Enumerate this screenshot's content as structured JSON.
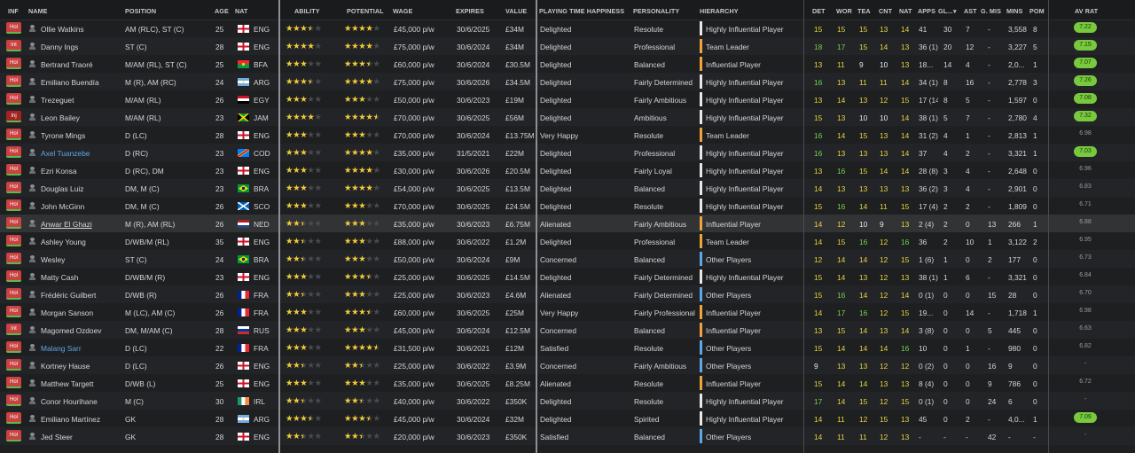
{
  "headers": {
    "inf": "INF",
    "name": "NAME",
    "position": "POSITION",
    "age": "AGE",
    "nat": "NAT",
    "ability": "ABILITY",
    "potential": "POTENTIAL",
    "wage": "WAGE",
    "expires": "EXPIRES",
    "value": "VALUE",
    "pth": "PLAYING TIME HAPPINESS",
    "personality": "PERSONALITY",
    "hierarchy": "HIERARCHY",
    "det": "DET",
    "wor": "WOR",
    "tea": "TEA",
    "cnt": "CNT",
    "nat2": "NAT",
    "apps": "APPS",
    "gls": "GL...",
    "sort_icon": "sort-desc-icon",
    "ast": "AST",
    "gmis": "G. MIS",
    "mins": "MINS",
    "pom": "POM",
    "avrat": "AV RAT"
  },
  "colors": {
    "badge": "#c94141",
    "star": "#f2cb3a",
    "good_rating": "#79c93e",
    "hierarchy_leader": "#f2a43a",
    "hierarchy_other": "#5da8e6",
    "hierarchy_high": "#e8e8e8"
  },
  "players": [
    {
      "inf": "Hol",
      "name": "Ollie Watkins",
      "position": "AM (RLC), ST (C)",
      "age": "25",
      "flag": "eng",
      "nat": "ENG",
      "ability": 3.5,
      "potential": 4,
      "wage": "£45,000 p/w",
      "expires": "30/6/2025",
      "value": "£34M",
      "pth": "Delighted",
      "personality": "Resolute",
      "hierarchy": "Highly Influential Player",
      "htier": "high",
      "det": "15",
      "wor": "15",
      "tea": "15",
      "cnt": "13",
      "nat2": "14",
      "apps": "41",
      "gls": "30",
      "ast": "7",
      "gmis": "-",
      "mins": "3,558",
      "pom": "8",
      "avrat": "7.22",
      "avgood": true
    },
    {
      "inf": "Int",
      "name": "Danny Ings",
      "position": "ST (C)",
      "age": "28",
      "flag": "eng",
      "nat": "ENG",
      "ability": 4,
      "potential": 4,
      "wage": "£75,000 p/w",
      "expires": "30/6/2024",
      "value": "£34M",
      "pth": "Delighted",
      "personality": "Professional",
      "hierarchy": "Team Leader",
      "htier": "leader",
      "det": "18",
      "wor": "17",
      "tea": "15",
      "cnt": "14",
      "nat2": "13",
      "apps": "36 (1)",
      "gls": "20",
      "ast": "12",
      "gmis": "-",
      "mins": "3,227",
      "pom": "5",
      "avrat": "7.15",
      "avgood": true
    },
    {
      "inf": "Hol",
      "name": "Bertrand Traoré",
      "position": "M/AM (RL), ST (C)",
      "age": "25",
      "flag": "bfa",
      "nat": "BFA",
      "ability": 3,
      "potential": 3.5,
      "wage": "£60,000 p/w",
      "expires": "30/6/2024",
      "value": "£30.5M",
      "pth": "Delighted",
      "personality": "Balanced",
      "hierarchy": "Influential Player",
      "htier": "leader",
      "det": "13",
      "wor": "11",
      "tea": "9",
      "cnt": "10",
      "nat2": "13",
      "apps": "18...",
      "gls": "14",
      "ast": "4",
      "gmis": "-",
      "mins": "2,0...",
      "pom": "1",
      "avrat": "7.07",
      "avgood": true
    },
    {
      "inf": "Hol",
      "name": "Emiliano Buendía",
      "position": "M (R), AM (RC)",
      "age": "24",
      "flag": "arg",
      "nat": "ARG",
      "ability": 3.5,
      "potential": 4,
      "wage": "£75,000 p/w",
      "expires": "30/6/2026",
      "value": "£34.5M",
      "pth": "Delighted",
      "personality": "Fairly Determined",
      "hierarchy": "Highly Influential Player",
      "htier": "high",
      "det": "16",
      "wor": "13",
      "tea": "11",
      "cnt": "11",
      "nat2": "14",
      "apps": "34 (1)",
      "gls": "8",
      "ast": "16",
      "gmis": "-",
      "mins": "2,778",
      "pom": "3",
      "avrat": "7.26",
      "avgood": true
    },
    {
      "inf": "Hol",
      "name": "Trezeguet",
      "position": "M/AM (RL)",
      "age": "26",
      "flag": "egy",
      "nat": "EGY",
      "ability": 3,
      "potential": 3,
      "wage": "£50,000 p/w",
      "expires": "30/6/2023",
      "value": "£19M",
      "pth": "Delighted",
      "personality": "Fairly Ambitious",
      "hierarchy": "Highly Influential Player",
      "htier": "high",
      "det": "13",
      "wor": "14",
      "tea": "13",
      "cnt": "12",
      "nat2": "15",
      "apps": "17 (14)",
      "gls": "8",
      "ast": "5",
      "gmis": "-",
      "mins": "1,597",
      "pom": "0",
      "avrat": "7.08",
      "avgood": true
    },
    {
      "inf": "Inj",
      "name": "Leon Bailey",
      "position": "M/AM (RL)",
      "age": "23",
      "flag": "jam",
      "nat": "JAM",
      "ability": 4,
      "potential": 4.5,
      "wage": "£70,000 p/w",
      "expires": "30/6/2025",
      "value": "£56M",
      "pth": "Delighted",
      "personality": "Ambitious",
      "hierarchy": "Highly Influential Player",
      "htier": "high",
      "det": "15",
      "wor": "13",
      "tea": "10",
      "cnt": "10",
      "nat2": "14",
      "apps": "38 (1)",
      "gls": "5",
      "ast": "7",
      "gmis": "-",
      "mins": "2,780",
      "pom": "4",
      "avrat": "7.32",
      "avgood": true
    },
    {
      "inf": "Hol",
      "name": "Tyrone Mings",
      "position": "D (LC)",
      "age": "28",
      "flag": "eng",
      "nat": "ENG",
      "ability": 3,
      "potential": 3,
      "wage": "£70,000 p/w",
      "expires": "30/6/2024",
      "value": "£13.75M",
      "pth": "Very Happy",
      "personality": "Resolute",
      "hierarchy": "Team Leader",
      "htier": "leader",
      "det": "16",
      "wor": "14",
      "tea": "15",
      "cnt": "13",
      "nat2": "14",
      "apps": "31 (2)",
      "gls": "4",
      "ast": "1",
      "gmis": "-",
      "mins": "2,813",
      "pom": "1",
      "avrat": "6.98",
      "avgood": false
    },
    {
      "inf": "Hol",
      "name": "Axel Tuanzebe",
      "position": "D (RC)",
      "age": "23",
      "flag": "cod",
      "nat": "COD",
      "ability": 3,
      "potential": 4,
      "wage": "£35,000 p/w",
      "expires": "31/5/2021",
      "value": "£22M",
      "pth": "Delighted",
      "personality": "Professional",
      "hierarchy": "Highly Influential Player",
      "htier": "high",
      "det": "16",
      "wor": "13",
      "tea": "13",
      "cnt": "13",
      "nat2": "14",
      "apps": "37",
      "gls": "4",
      "ast": "2",
      "gmis": "-",
      "mins": "3,321",
      "pom": "1",
      "avrat": "7.03",
      "avgood": true,
      "loan": true
    },
    {
      "inf": "Hol",
      "name": "Ezri Konsa",
      "position": "D (RC), DM",
      "age": "23",
      "flag": "eng",
      "nat": "ENG",
      "ability": 3,
      "potential": 4,
      "wage": "£30,000 p/w",
      "expires": "30/6/2026",
      "value": "£20.5M",
      "pth": "Delighted",
      "personality": "Fairly Loyal",
      "hierarchy": "Highly Influential Player",
      "htier": "high",
      "det": "13",
      "wor": "16",
      "tea": "15",
      "cnt": "14",
      "nat2": "14",
      "apps": "28 (8)",
      "gls": "3",
      "ast": "4",
      "gmis": "-",
      "mins": "2,648",
      "pom": "0",
      "avrat": "6.96",
      "avgood": false
    },
    {
      "inf": "Hol",
      "name": "Douglas Luiz",
      "position": "DM, M (C)",
      "age": "23",
      "flag": "bra",
      "nat": "BRA",
      "ability": 3,
      "potential": 4,
      "wage": "£54,000 p/w",
      "expires": "30/6/2025",
      "value": "£13.5M",
      "pth": "Delighted",
      "personality": "Balanced",
      "hierarchy": "Highly Influential Player",
      "htier": "high",
      "det": "14",
      "wor": "13",
      "tea": "13",
      "cnt": "13",
      "nat2": "13",
      "apps": "36 (2)",
      "gls": "3",
      "ast": "4",
      "gmis": "-",
      "mins": "2,901",
      "pom": "0",
      "avrat": "6.83",
      "avgood": false
    },
    {
      "inf": "Hol",
      "name": "John McGinn",
      "position": "DM, M (C)",
      "age": "26",
      "flag": "sco",
      "nat": "SCO",
      "ability": 3,
      "potential": 3,
      "wage": "£70,000 p/w",
      "expires": "30/6/2025",
      "value": "£24.5M",
      "pth": "Delighted",
      "personality": "Resolute",
      "hierarchy": "Highly Influential Player",
      "htier": "high",
      "det": "15",
      "wor": "16",
      "tea": "14",
      "cnt": "11",
      "nat2": "15",
      "apps": "17 (4)",
      "gls": "2",
      "ast": "2",
      "gmis": "-",
      "mins": "1,809",
      "pom": "0",
      "avrat": "6.71",
      "avgood": false
    },
    {
      "inf": "Hol",
      "name": "Anwar El Ghazi",
      "position": "M (R), AM (RL)",
      "age": "26",
      "flag": "ned",
      "nat": "NED",
      "ability": 2.5,
      "potential": 3,
      "wage": "£35,000 p/w",
      "expires": "30/6/2023",
      "value": "£6.75M",
      "pth": "Alienated",
      "personality": "Fairly Ambitious",
      "hierarchy": "Influential Player",
      "htier": "leader",
      "det": "14",
      "wor": "12",
      "tea": "10",
      "cnt": "9",
      "nat2": "13",
      "apps": "2 (4)",
      "gls": "2",
      "ast": "0",
      "gmis": "13",
      "mins": "266",
      "pom": "1",
      "avrat": "6.88",
      "avgood": false,
      "highlight": true
    },
    {
      "inf": "Hol",
      "name": "Ashley Young",
      "position": "D/WB/M (RL)",
      "age": "35",
      "flag": "eng",
      "nat": "ENG",
      "ability": 2.5,
      "potential": 3,
      "wage": "£88,000 p/w",
      "expires": "30/6/2022",
      "value": "£1.2M",
      "pth": "Delighted",
      "personality": "Professional",
      "hierarchy": "Team Leader",
      "htier": "leader",
      "det": "14",
      "wor": "15",
      "tea": "16",
      "cnt": "12",
      "nat2": "16",
      "apps": "36",
      "gls": "2",
      "ast": "10",
      "gmis": "1",
      "mins": "3,122",
      "pom": "2",
      "avrat": "6.95",
      "avgood": false
    },
    {
      "inf": "Hol",
      "name": "Wesley",
      "position": "ST (C)",
      "age": "24",
      "flag": "bra",
      "nat": "BRA",
      "ability": 2.5,
      "potential": 3,
      "wage": "£50,000 p/w",
      "expires": "30/6/2024",
      "value": "£9M",
      "pth": "Concerned",
      "personality": "Balanced",
      "hierarchy": "Other Players",
      "htier": "other",
      "det": "12",
      "wor": "14",
      "tea": "14",
      "cnt": "12",
      "nat2": "15",
      "apps": "1 (6)",
      "gls": "1",
      "ast": "0",
      "gmis": "2",
      "mins": "177",
      "pom": "0",
      "avrat": "6.73",
      "avgood": false
    },
    {
      "inf": "Hol",
      "name": "Matty Cash",
      "position": "D/WB/M (R)",
      "age": "23",
      "flag": "eng",
      "nat": "ENG",
      "ability": 3,
      "potential": 3.5,
      "wage": "£25,000 p/w",
      "expires": "30/6/2025",
      "value": "£14.5M",
      "pth": "Delighted",
      "personality": "Fairly Determined",
      "hierarchy": "Highly Influential Player",
      "htier": "high",
      "det": "15",
      "wor": "14",
      "tea": "13",
      "cnt": "12",
      "nat2": "13",
      "apps": "38 (1)",
      "gls": "1",
      "ast": "6",
      "gmis": "-",
      "mins": "3,321",
      "pom": "0",
      "avrat": "6.84",
      "avgood": false
    },
    {
      "inf": "Hol",
      "name": "Frédéric Guilbert",
      "position": "D/WB (R)",
      "age": "26",
      "flag": "fra",
      "nat": "FRA",
      "ability": 2.5,
      "potential": 3,
      "wage": "£25,000 p/w",
      "expires": "30/6/2023",
      "value": "£4.6M",
      "pth": "Alienated",
      "personality": "Fairly Determined",
      "hierarchy": "Other Players",
      "htier": "other",
      "det": "15",
      "wor": "16",
      "tea": "14",
      "cnt": "12",
      "nat2": "14",
      "apps": "0 (1)",
      "gls": "0",
      "ast": "0",
      "gmis": "15",
      "mins": "28",
      "pom": "0",
      "avrat": "6.70",
      "avgood": false
    },
    {
      "inf": "Hol",
      "name": "Morgan Sanson",
      "position": "M (LC), AM (C)",
      "age": "26",
      "flag": "fra",
      "nat": "FRA",
      "ability": 3,
      "potential": 3.5,
      "wage": "£60,000 p/w",
      "expires": "30/6/2025",
      "value": "£25M",
      "pth": "Very Happy",
      "personality": "Fairly Professional",
      "hierarchy": "Influential Player",
      "htier": "leader",
      "det": "14",
      "wor": "17",
      "tea": "16",
      "cnt": "12",
      "nat2": "15",
      "apps": "19...",
      "gls": "0",
      "ast": "14",
      "gmis": "-",
      "mins": "1,718",
      "pom": "1",
      "avrat": "6.98",
      "avgood": false
    },
    {
      "inf": "Int",
      "name": "Magomed Ozdoev",
      "position": "DM, M/AM (C)",
      "age": "28",
      "flag": "rus",
      "nat": "RUS",
      "ability": 3,
      "potential": 3,
      "wage": "£45,000 p/w",
      "expires": "30/6/2024",
      "value": "£12.5M",
      "pth": "Concerned",
      "personality": "Balanced",
      "hierarchy": "Influential Player",
      "htier": "leader",
      "det": "13",
      "wor": "15",
      "tea": "14",
      "cnt": "13",
      "nat2": "14",
      "apps": "3 (8)",
      "gls": "0",
      "ast": "0",
      "gmis": "5",
      "mins": "445",
      "pom": "0",
      "avrat": "6.63",
      "avgood": false
    },
    {
      "inf": "Hol",
      "name": "Malang Sarr",
      "position": "D (LC)",
      "age": "22",
      "flag": "fra",
      "nat": "FRA",
      "ability": 3,
      "potential": 4.5,
      "wage": "£31,500 p/w",
      "expires": "30/6/2021",
      "value": "£12M",
      "pth": "Satisfied",
      "personality": "Resolute",
      "hierarchy": "Other Players",
      "htier": "other",
      "det": "15",
      "wor": "14",
      "tea": "14",
      "cnt": "14",
      "nat2": "16",
      "apps": "10",
      "gls": "0",
      "ast": "1",
      "gmis": "-",
      "mins": "980",
      "pom": "0",
      "avrat": "6.82",
      "avgood": false,
      "loan": true
    },
    {
      "inf": "Hol",
      "name": "Kortney Hause",
      "position": "D (LC)",
      "age": "26",
      "flag": "eng",
      "nat": "ENG",
      "ability": 2.5,
      "potential": 2.5,
      "wage": "£25,000 p/w",
      "expires": "30/6/2022",
      "value": "£3.9M",
      "pth": "Concerned",
      "personality": "Fairly Ambitious",
      "hierarchy": "Other Players",
      "htier": "other",
      "det": "9",
      "wor": "13",
      "tea": "13",
      "cnt": "12",
      "nat2": "12",
      "apps": "0 (2)",
      "gls": "0",
      "ast": "0",
      "gmis": "16",
      "mins": "9",
      "pom": "0",
      "avrat": "-",
      "avgood": false
    },
    {
      "inf": "Hol",
      "name": "Matthew Targett",
      "position": "D/WB (L)",
      "age": "25",
      "flag": "eng",
      "nat": "ENG",
      "ability": 3,
      "potential": 3,
      "wage": "£35,000 p/w",
      "expires": "30/6/2025",
      "value": "£8.25M",
      "pth": "Alienated",
      "personality": "Resolute",
      "hierarchy": "Influential Player",
      "htier": "leader",
      "det": "15",
      "wor": "14",
      "tea": "14",
      "cnt": "13",
      "nat2": "13",
      "apps": "8 (4)",
      "gls": "0",
      "ast": "0",
      "gmis": "9",
      "mins": "786",
      "pom": "0",
      "avrat": "6.72",
      "avgood": false
    },
    {
      "inf": "Hol",
      "name": "Conor Hourihane",
      "position": "M (C)",
      "age": "30",
      "flag": "irl",
      "nat": "IRL",
      "ability": 2.5,
      "potential": 2.5,
      "wage": "£40,000 p/w",
      "expires": "30/6/2022",
      "value": "£350K",
      "pth": "Delighted",
      "personality": "Resolute",
      "hierarchy": "Highly Influential Player",
      "htier": "high",
      "det": "17",
      "wor": "14",
      "tea": "15",
      "cnt": "12",
      "nat2": "15",
      "apps": "0 (1)",
      "gls": "0",
      "ast": "0",
      "gmis": "24",
      "mins": "6",
      "pom": "0",
      "avrat": "-",
      "avgood": false
    },
    {
      "inf": "Hol",
      "name": "Emiliano Martínez",
      "position": "GK",
      "age": "28",
      "flag": "arg",
      "nat": "ARG",
      "ability": 3.5,
      "potential": 3.5,
      "wage": "£45,000 p/w",
      "expires": "30/6/2024",
      "value": "£32M",
      "pth": "Delighted",
      "personality": "Spirited",
      "hierarchy": "Highly Influential Player",
      "htier": "high",
      "det": "14",
      "wor": "11",
      "tea": "12",
      "cnt": "15",
      "nat2": "13",
      "apps": "45",
      "gls": "0",
      "ast": "2",
      "gmis": "-",
      "mins": "4,0...",
      "pom": "1",
      "avrat": "7.09",
      "avgood": true
    },
    {
      "inf": "Hol",
      "name": "Jed Steer",
      "position": "GK",
      "age": "28",
      "flag": "eng",
      "nat": "ENG",
      "ability": 2.5,
      "potential": 2.5,
      "wage": "£20,000 p/w",
      "expires": "30/6/2023",
      "value": "£350K",
      "pth": "Satisfied",
      "personality": "Balanced",
      "hierarchy": "Other Players",
      "htier": "other",
      "det": "14",
      "wor": "11",
      "tea": "11",
      "cnt": "12",
      "nat2": "13",
      "apps": "-",
      "gls": "-",
      "ast": "-",
      "gmis": "42",
      "mins": "-",
      "pom": "-",
      "avrat": "-",
      "avgood": false
    }
  ]
}
